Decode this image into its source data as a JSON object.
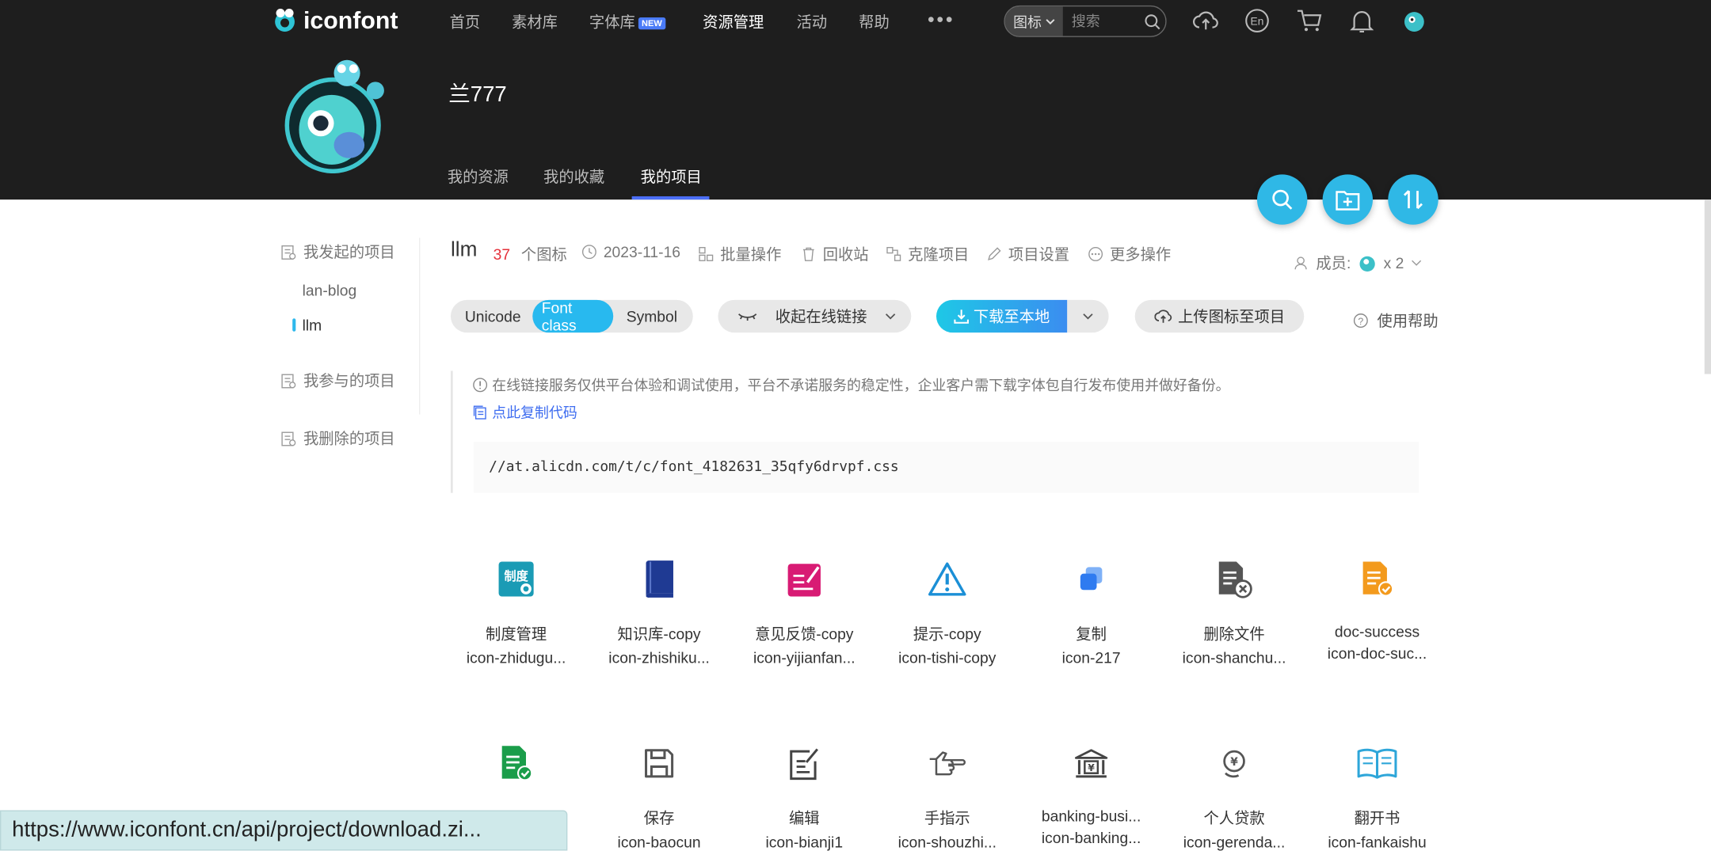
{
  "header": {
    "logo_text": "iconfont",
    "nav": [
      "首页",
      "素材库",
      "字体库",
      "资源管理",
      "活动",
      "帮助"
    ],
    "nav_active": "资源管理",
    "new_badge": "NEW",
    "more": "•••",
    "search_select": "图标",
    "search_placeholder": "搜索"
  },
  "profile": {
    "username": "兰777",
    "tabs": [
      "我的资源",
      "我的收藏",
      "我的项目"
    ],
    "active_tab": "我的项目"
  },
  "sidebar": {
    "started": "我发起的项目",
    "projects": [
      "lan-blog",
      "llm"
    ],
    "participated": "我参与的项目",
    "deleted": "我删除的项目"
  },
  "project": {
    "name": "llm",
    "count": "37",
    "count_label": "个图标",
    "date": "2023-11-16",
    "actions": [
      "批量操作",
      "回收站",
      "克隆项目",
      "项目设置",
      "更多操作"
    ],
    "members_label": "成员:",
    "members_count": "x 2"
  },
  "toolbar": {
    "segments": [
      "Unicode",
      "Font class",
      "Symbol"
    ],
    "active_segment": "Font class",
    "collapse_link": "收起在线链接",
    "download": "下载至本地",
    "upload": "上传图标至项目",
    "help": "使用帮助"
  },
  "notice": {
    "text": "在线链接服务仅供平台体验和调试使用，平台不承诺服务的稳定性，企业客户需下载字体包自行发布使用并做好备份。",
    "copy_code": "点此复制代码",
    "url": "//at.alicdn.com/t/c/font_4182631_35qfy6drvpf.css"
  },
  "icons": [
    {
      "name": "制度管理",
      "code": "icon-zhidugu...",
      "icon": "regulation-icon",
      "color": "#1a9bb5"
    },
    {
      "name": "知识库-copy",
      "code": "icon-zhishiku...",
      "icon": "book-icon",
      "color": "#1f3a93"
    },
    {
      "name": "意见反馈-copy",
      "code": "icon-yijianfan...",
      "icon": "feedback-icon",
      "color": "#d81b74"
    },
    {
      "name": "提示-copy",
      "code": "icon-tishi-copy",
      "icon": "warning-icon",
      "color": "#1b8fd6"
    },
    {
      "name": "复制",
      "code": "icon-217",
      "icon": "copy-icon",
      "color": "#2f7bf0"
    },
    {
      "name": "删除文件",
      "code": "icon-shanchu...",
      "icon": "delete-file-icon",
      "color": "#555555"
    },
    {
      "name": "doc-success",
      "code": "icon-doc-suc...",
      "icon": "doc-success-icon",
      "color": "#f39a1d"
    },
    {
      "name": "",
      "code": "",
      "icon": "doc-check-icon",
      "color": "#1a9d4a"
    },
    {
      "name": "保存",
      "code": "icon-baocun",
      "icon": "save-icon",
      "color": "#555555"
    },
    {
      "name": "编辑",
      "code": "icon-bianji1",
      "icon": "edit-icon",
      "color": "#444444"
    },
    {
      "name": "手指示",
      "code": "icon-shouzhi...",
      "icon": "hand-point-icon",
      "color": "#555555"
    },
    {
      "name": "banking-busi...",
      "code": "icon-banking...",
      "icon": "bank-icon",
      "color": "#444444"
    },
    {
      "name": "个人贷款",
      "code": "icon-gerenda...",
      "icon": "loan-icon",
      "color": "#555555"
    },
    {
      "name": "翻开书",
      "code": "icon-fankaishu",
      "icon": "open-book-icon",
      "color": "#2ea6d9"
    }
  ],
  "status_bar": "https://www.iconfont.cn/api/project/download.zi..."
}
